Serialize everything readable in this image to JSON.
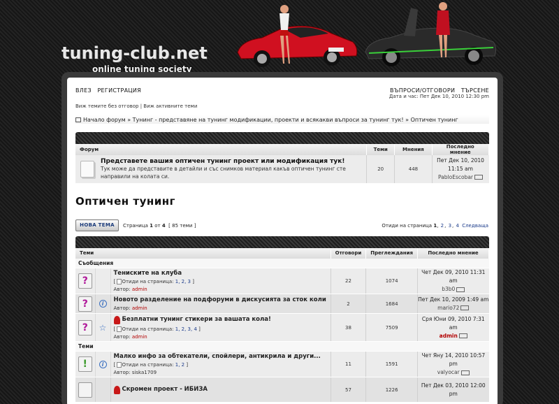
{
  "header": {
    "logo": "tuning-club.net",
    "slogan": "online tuning society"
  },
  "nav": {
    "login": "ВЛЕЗ",
    "register": "РЕГИСТРАЦИЯ",
    "faq": "ВЪПРОСИ/ОТГОВОРИ",
    "search": "ТЪРСЕНЕ",
    "unanswered": "Виж темите без отговор",
    "separator": "|",
    "active": "Виж активните теми",
    "datetime": "Дата и час: Пет Дек 10, 2010 12:30 pm"
  },
  "breadcrumb": "Начало форум » Тунинг - представяне на тунинг модификации, проекти и всякакви въпроси за тунинг тук! » Оптичен тунинг",
  "forum_table": {
    "headers": [
      "Форум",
      "Теми",
      "Мнения",
      "Последно мнение"
    ],
    "row": {
      "title": "Представете вашия оптичен тунинг проект или модификация тук!",
      "desc": "Тук може да представите в детайли и със снимков материал какъв оптичен тунинг сте направили на колата си.",
      "topics": "20",
      "posts": "448",
      "last_date": "Пет Дек 10, 2010 11:15 am",
      "last_author": "PabloEscobar"
    }
  },
  "page_title": "Оптичен тунинг",
  "actions": {
    "new_topic": "НОВА ТЕМА",
    "page_prefix": "Страница",
    "page_current": "1",
    "page_of": "от",
    "page_total": "4",
    "topics_count": "[ 85 теми ]",
    "goto": "Отиди на страница",
    "pages": [
      "1",
      "2",
      "3",
      "4"
    ],
    "next": "Следваща"
  },
  "topics_table": {
    "headers": [
      "Теми",
      "Отговори",
      "Преглеждания",
      "Последно мнение"
    ],
    "cat_announcements": "Съобщения",
    "cat_topics": "Теми",
    "goto_label": "Отиди на страница:",
    "author_label": "Автор:",
    "rows": [
      {
        "title": "Тениските на клуба",
        "pages": "1, 2, 3",
        "author": "admin",
        "replies": "22",
        "views": "1074",
        "last_date": "Чет Дек 09, 2010 11:31 am",
        "last_author": "b3b0"
      },
      {
        "title": "Новото разделение на подфоруми в дискусията за сток коли",
        "pages": "",
        "author": "admin",
        "replies": "2",
        "views": "1684",
        "last_date": "Пет Дек 10, 2009 1:49 am",
        "last_author": "mario72"
      },
      {
        "title": "Безплатни тунинг стикери за вашата кола!",
        "pages": "1, 2, 3, 4",
        "author": "admin",
        "replies": "38",
        "views": "7509",
        "last_date": "Сря Юни 09, 2010 7:31 am",
        "last_author": "admin"
      },
      {
        "title": "Малко инфо за обтекатели, спойлери, антикрила и други...",
        "pages": "1, 2",
        "author": "siska1709",
        "replies": "11",
        "views": "1591",
        "last_date": "Чет Яну 14, 2010 10:57 pm",
        "last_author": "valyocar"
      },
      {
        "title": "Скромен проект - ИБИЗА",
        "pages": "",
        "author": "",
        "replies": "57",
        "views": "1226",
        "last_date": "Пет Дек 03, 2010 12:00 pm",
        "last_author": ""
      }
    ]
  }
}
